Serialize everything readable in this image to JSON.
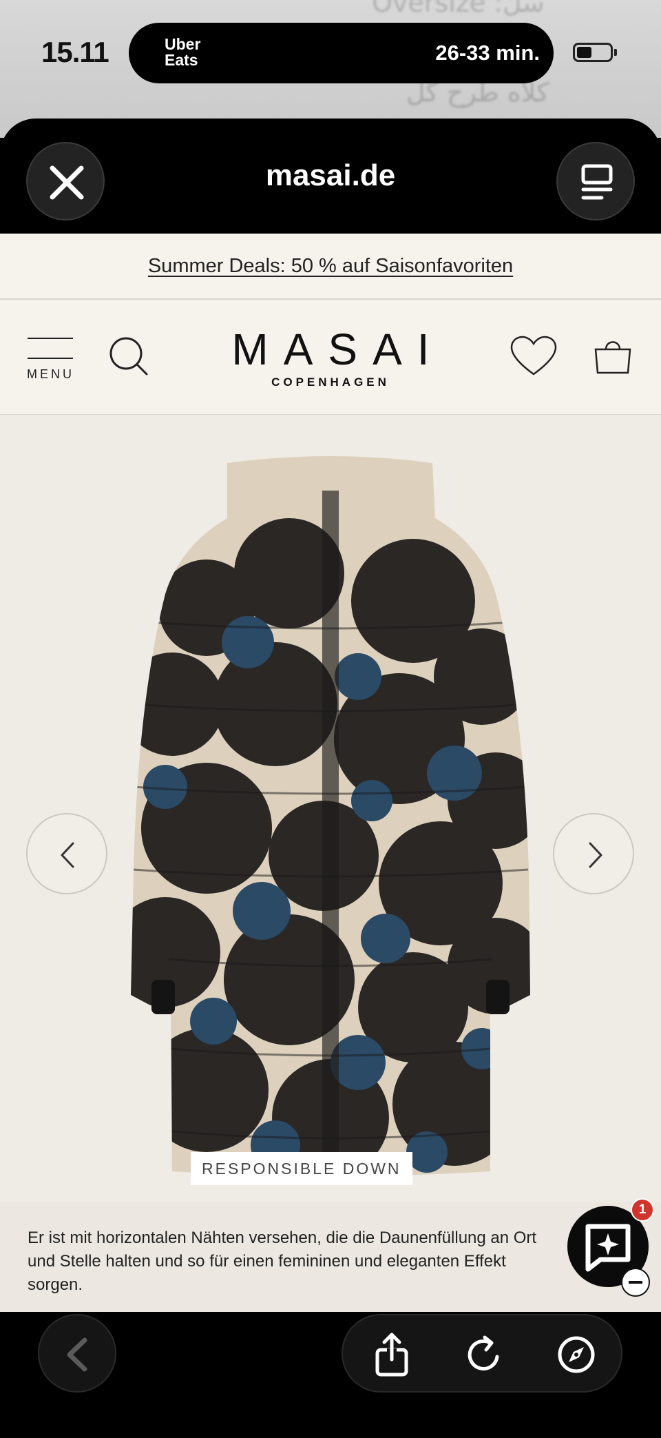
{
  "status_bar": {
    "time": "15.11",
    "island_app_line1": "Uber",
    "island_app_line2": "Eats",
    "island_eta": "26-33 min.",
    "battery_level": 0.45
  },
  "background_ghost_text": [
    "Oversize :سل",
    "کلاه طرح گل"
  ],
  "sheet": {
    "title": "masai.de",
    "close_icon": "close-icon",
    "menu_icon": "reader-icon"
  },
  "website": {
    "promo_text": "Summer Deals: 50 % auf Saisonfavoriten",
    "menu_label": "MENU",
    "logo_main": "MASAI",
    "logo_sub": "COPENHAGEN",
    "icons": [
      "hamburger-icon",
      "search-icon",
      "heart-icon",
      "bag-icon"
    ]
  },
  "product": {
    "badge": "RESPONSIBLE DOWN",
    "description": "Er ist mit horizontalen Nähten versehen, die die Daunenfüllung an Ort und Stelle halten und so für einen femininen und eleganten Effekt sorgen.",
    "image_alt": "printed-puffer-coat"
  },
  "chat": {
    "unread_count": "1",
    "icon": "chat-sparkle-icon"
  },
  "toolbar": {
    "icons": [
      "back-icon",
      "share-icon",
      "reload-icon",
      "compass-icon"
    ]
  },
  "colors": {
    "accent_black": "#000000",
    "page_bg": "#f4f1ea",
    "badge_red": "#d0342c"
  }
}
